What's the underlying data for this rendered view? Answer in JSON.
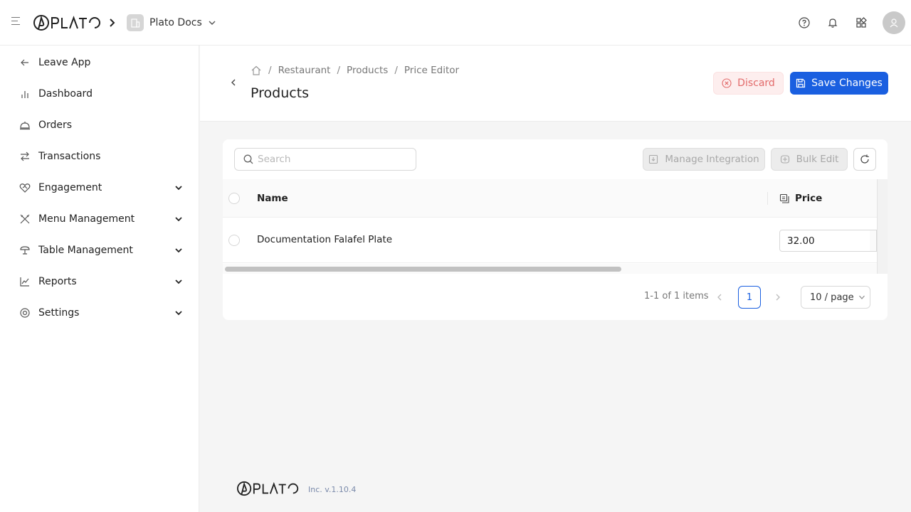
{
  "header": {
    "brand": "PLATO",
    "app_name": "Plato Docs"
  },
  "sidebar": {
    "items": [
      {
        "label": "Leave App",
        "icon": "arrow-left-icon",
        "expandable": false
      },
      {
        "label": "Dashboard",
        "icon": "bar-chart-icon",
        "expandable": false
      },
      {
        "label": "Orders",
        "icon": "cloche-icon",
        "expandable": false
      },
      {
        "label": "Transactions",
        "icon": "swap-icon",
        "expandable": false
      },
      {
        "label": "Engagement",
        "icon": "heart-handshake-icon",
        "expandable": true
      },
      {
        "label": "Menu Management",
        "icon": "utensils-icon",
        "expandable": true
      },
      {
        "label": "Table Management",
        "icon": "table-icon",
        "expandable": true
      },
      {
        "label": "Reports",
        "icon": "line-chart-icon",
        "expandable": true
      },
      {
        "label": "Settings",
        "icon": "settings-icon",
        "expandable": true
      }
    ]
  },
  "page": {
    "breadcrumb": [
      "Restaurant",
      "Products",
      "Price Editor"
    ],
    "title": "Products",
    "discard_label": "Discard",
    "save_label": "Save Changes"
  },
  "toolbar": {
    "search_placeholder": "Search",
    "manage_integration_label": "Manage Integration",
    "bulk_edit_label": "Bulk Edit"
  },
  "table": {
    "columns": [
      "Name",
      "Price"
    ],
    "rows": [
      {
        "name": "Documentation Falafel Plate",
        "price": "32.00"
      }
    ]
  },
  "pagination": {
    "info": "1-1 of 1 items",
    "current_page": "1",
    "page_size": "10 / page"
  },
  "footer": {
    "brand": "PLATO",
    "version": "Inc. v.1.10.4"
  },
  "colors": {
    "primary": "#1a5fe0",
    "danger": "#e26a6a",
    "danger_bg": "#fdeeee"
  }
}
